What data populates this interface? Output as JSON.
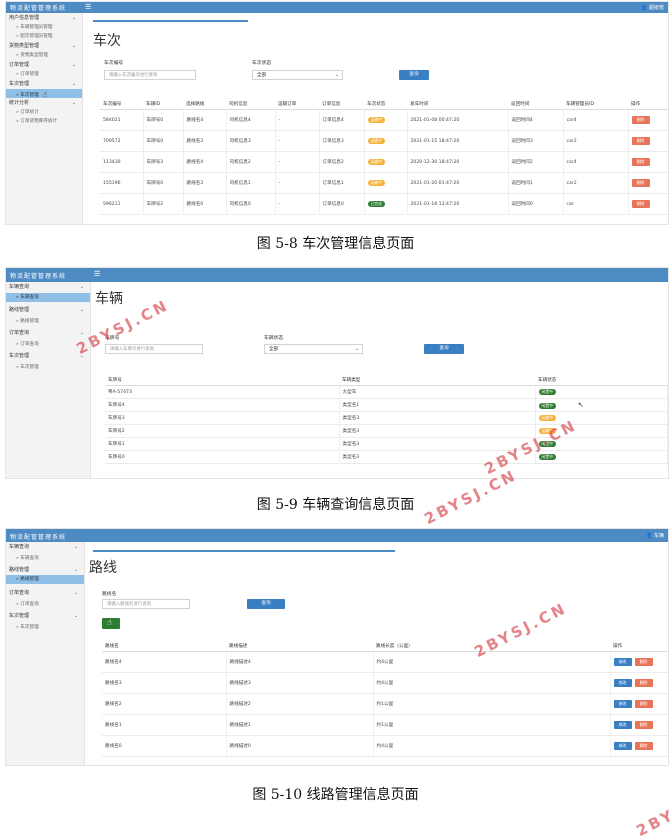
{
  "app_title": "物流配管管理系统",
  "screens": {
    "trips": {
      "user": "👤 超级管",
      "sidebar": {
        "groups": [
          {
            "label": "用户信息管理",
            "items": [
              "车辆管理员管理",
              "配次管理员管理"
            ]
          },
          {
            "label": "货物类型管理",
            "items": [
              "货物类型管理"
            ]
          },
          {
            "label": "订单管理",
            "items": [
              "订单管理"
            ]
          },
          {
            "label": "车次管理",
            "items": [
              "车次管理"
            ]
          },
          {
            "label": "统计分析",
            "items": [
              "订单统计",
              "订单货物库存统计"
            ]
          }
        ]
      },
      "title": "车次",
      "filters": {
        "trip_no_label": "车次编号",
        "trip_no_placeholder": "请输入车次编号进行查询",
        "status_label": "车次状态",
        "status_value": "全部",
        "query_label": "查询"
      },
      "columns": [
        "车次编号",
        "车辆ID",
        "选择路线",
        "司机信息",
        "运输订单",
        "订单信息",
        "车次状态",
        "发车时间",
        "返回时间",
        "车辆管理员ID",
        "操作"
      ],
      "rows": [
        {
          "no": "584021",
          "vehicle": "车牌号0",
          "route": "路线名4",
          "driver": "司机信息4",
          "order": "-",
          "order_info": "订单信息4",
          "status": "运输中",
          "status_color": "yellow",
          "depart": "2021-01-08 00:47:20",
          "return": "返回时间4",
          "admin": "car4",
          "action": "删除"
        },
        {
          "no": "709572",
          "vehicle": "车牌号0",
          "route": "路线名3",
          "driver": "司机信息3",
          "order": "-",
          "order_info": "订单信息3",
          "status": "运输中",
          "status_color": "yellow",
          "depart": "2021-01-15 18:47:20",
          "return": "返回时间3",
          "admin": "car2",
          "action": "删除"
        },
        {
          "no": "113430",
          "vehicle": "车牌号3",
          "route": "路线名4",
          "driver": "司机信息2",
          "order": "-",
          "order_info": "订单信息2",
          "status": "运输中",
          "status_color": "yellow",
          "depart": "2020-12-30 18:47:20",
          "return": "返回时间2",
          "admin": "car4",
          "action": "删除"
        },
        {
          "no": "155196",
          "vehicle": "车牌号0",
          "route": "路线名3",
          "driver": "司机信息1",
          "order": "-",
          "order_info": "订单信息1",
          "status": "运输中",
          "status_color": "yellow",
          "depart": "2021-01-20 01:47:20",
          "return": "返回时间1",
          "admin": "car2",
          "action": "删除"
        },
        {
          "no": "596211",
          "vehicle": "车牌号2",
          "route": "路线名0",
          "driver": "司机信息0",
          "order": "-",
          "order_info": "订单信息0",
          "status": "已完成",
          "status_color": "green",
          "depart": "2021-01-18 13:47:20",
          "return": "返回时间0",
          "admin": "car",
          "action": "删除"
        }
      ],
      "caption": "图 5-8 车次管理信息页面"
    },
    "vehicles": {
      "sidebar": {
        "groups": [
          {
            "label": "车辆查询",
            "items": [
              "车辆查询"
            ]
          },
          {
            "label": "路线管理",
            "items": [
              "路线管理"
            ]
          },
          {
            "label": "订单查询",
            "items": [
              "订单查询"
            ]
          },
          {
            "label": "车次管理",
            "items": [
              "车次管理"
            ]
          }
        ]
      },
      "title": "车辆",
      "filters": {
        "plate_label": "车牌号",
        "plate_placeholder": "请输入车牌号进行查询",
        "status_label": "车辆状态",
        "status_value": "全部",
        "query_label": "查询"
      },
      "columns": [
        "车牌号",
        "车辆类型",
        "车辆状态"
      ],
      "rows": [
        {
          "plate": "粤A-57473",
          "type": "大型车",
          "status": "闲置中",
          "status_color": "green"
        },
        {
          "plate": "车牌号4",
          "type": "类型名1",
          "status": "闲置中",
          "status_color": "green"
        },
        {
          "plate": "车牌号3",
          "type": "类型名3",
          "status": "运输中",
          "status_color": "yellow"
        },
        {
          "plate": "车牌号2",
          "type": "类型名3",
          "status": "运输中",
          "status_color": "yellow"
        },
        {
          "plate": "车牌号1",
          "type": "类型名3",
          "status": "闲置中",
          "status_color": "green"
        },
        {
          "plate": "车牌号0",
          "type": "类型名3",
          "status": "闲置中",
          "status_color": "green"
        }
      ],
      "caption": "图 5-9 车辆查询信息页面"
    },
    "routes": {
      "user": "👤 车辆",
      "sidebar": {
        "groups": [
          {
            "label": "车辆查询",
            "items": [
              "车辆查询"
            ]
          },
          {
            "label": "路线管理",
            "items": [
              "路线管理"
            ]
          },
          {
            "label": "订单查询",
            "items": [
              "订单查询"
            ]
          },
          {
            "label": "车次管理",
            "items": [
              "车次管理"
            ]
          }
        ]
      },
      "title": "路线",
      "filters": {
        "name_label": "路线名",
        "name_placeholder": "请输入路线名进行查询",
        "query_label": "查询"
      },
      "columns": [
        "路线名",
        "路线描述",
        "路线长度（公里）",
        "操作"
      ],
      "rows": [
        {
          "name": "路线名4",
          "desc": "路线描述4",
          "length": "约4公里",
          "edit": "修改",
          "del": "删除"
        },
        {
          "name": "路线名3",
          "desc": "路线描述3",
          "length": "约4公里",
          "edit": "修改",
          "del": "删除"
        },
        {
          "name": "路线名2",
          "desc": "路线描述2",
          "length": "约1公里",
          "edit": "修改",
          "del": "删除"
        },
        {
          "name": "路线名1",
          "desc": "路线描述1",
          "length": "约1公里",
          "edit": "修改",
          "del": "删除"
        },
        {
          "name": "路线名0",
          "desc": "路线描述0",
          "length": "约4公里",
          "edit": "修改",
          "del": "删除"
        }
      ],
      "caption": "图 5-10 线路管理信息页面"
    }
  },
  "watermark": "2BYSJ.CN",
  "colors": {
    "topbar": "#4f8bc3",
    "primary": "#3a7fc2",
    "danger": "#e8755a",
    "warning": "#f3b23c",
    "success": "#2e7d32",
    "watermark": "#d64148"
  }
}
